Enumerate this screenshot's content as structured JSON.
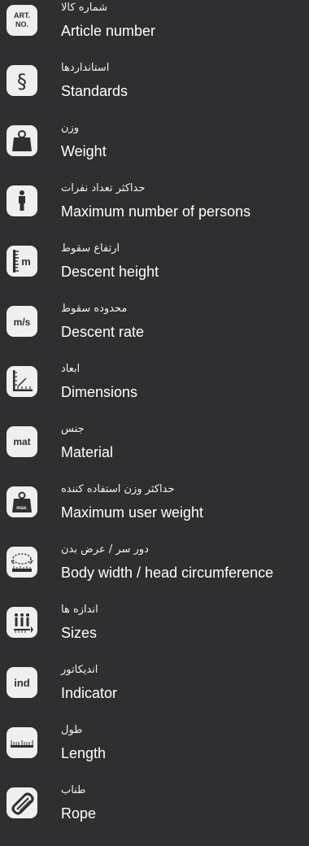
{
  "items": [
    {
      "icon": "article-number-icon",
      "icon_text": [
        "ART.",
        "NO."
      ],
      "label_fa": "شماره کالا",
      "label_en": "Article number"
    },
    {
      "icon": "standards-icon",
      "icon_text": "§",
      "label_fa": "استانداردها",
      "label_en": "Standards"
    },
    {
      "icon": "weight-icon",
      "label_fa": "وزن",
      "label_en": "Weight"
    },
    {
      "icon": "person-icon",
      "label_fa": "حداکثر تعداد نفرات",
      "label_en": "Maximum number of persons"
    },
    {
      "icon": "descent-height-icon",
      "icon_text": "m",
      "label_fa": "ارتفاع سقوط",
      "label_en": "Descent height"
    },
    {
      "icon": "descent-rate-icon",
      "icon_text": "m/s",
      "label_fa": "محدوده سقوط",
      "label_en": "Descent rate"
    },
    {
      "icon": "dimensions-icon",
      "label_fa": "ابعاد",
      "label_en": "Dimensions"
    },
    {
      "icon": "material-icon",
      "icon_text": "mat",
      "label_fa": "جنس",
      "label_en": "Material"
    },
    {
      "icon": "max-user-weight-icon",
      "icon_text": "max.",
      "label_fa": "حداکثر وزن استفاده کننده",
      "label_en": "Maximum user weight"
    },
    {
      "icon": "body-width-icon",
      "label_fa": "دور سر / عرض بدن",
      "label_en": "Body width / head circumference"
    },
    {
      "icon": "sizes-icon",
      "label_fa": "اندازه ها",
      "label_en": "Sizes"
    },
    {
      "icon": "indicator-icon",
      "icon_text": "ind",
      "label_fa": "اندیکاتور",
      "label_en": "Indicator"
    },
    {
      "icon": "length-icon",
      "label_fa": "طول",
      "label_en": "Length"
    },
    {
      "icon": "rope-icon",
      "label_fa": "طناب",
      "label_en": "Rope"
    }
  ]
}
